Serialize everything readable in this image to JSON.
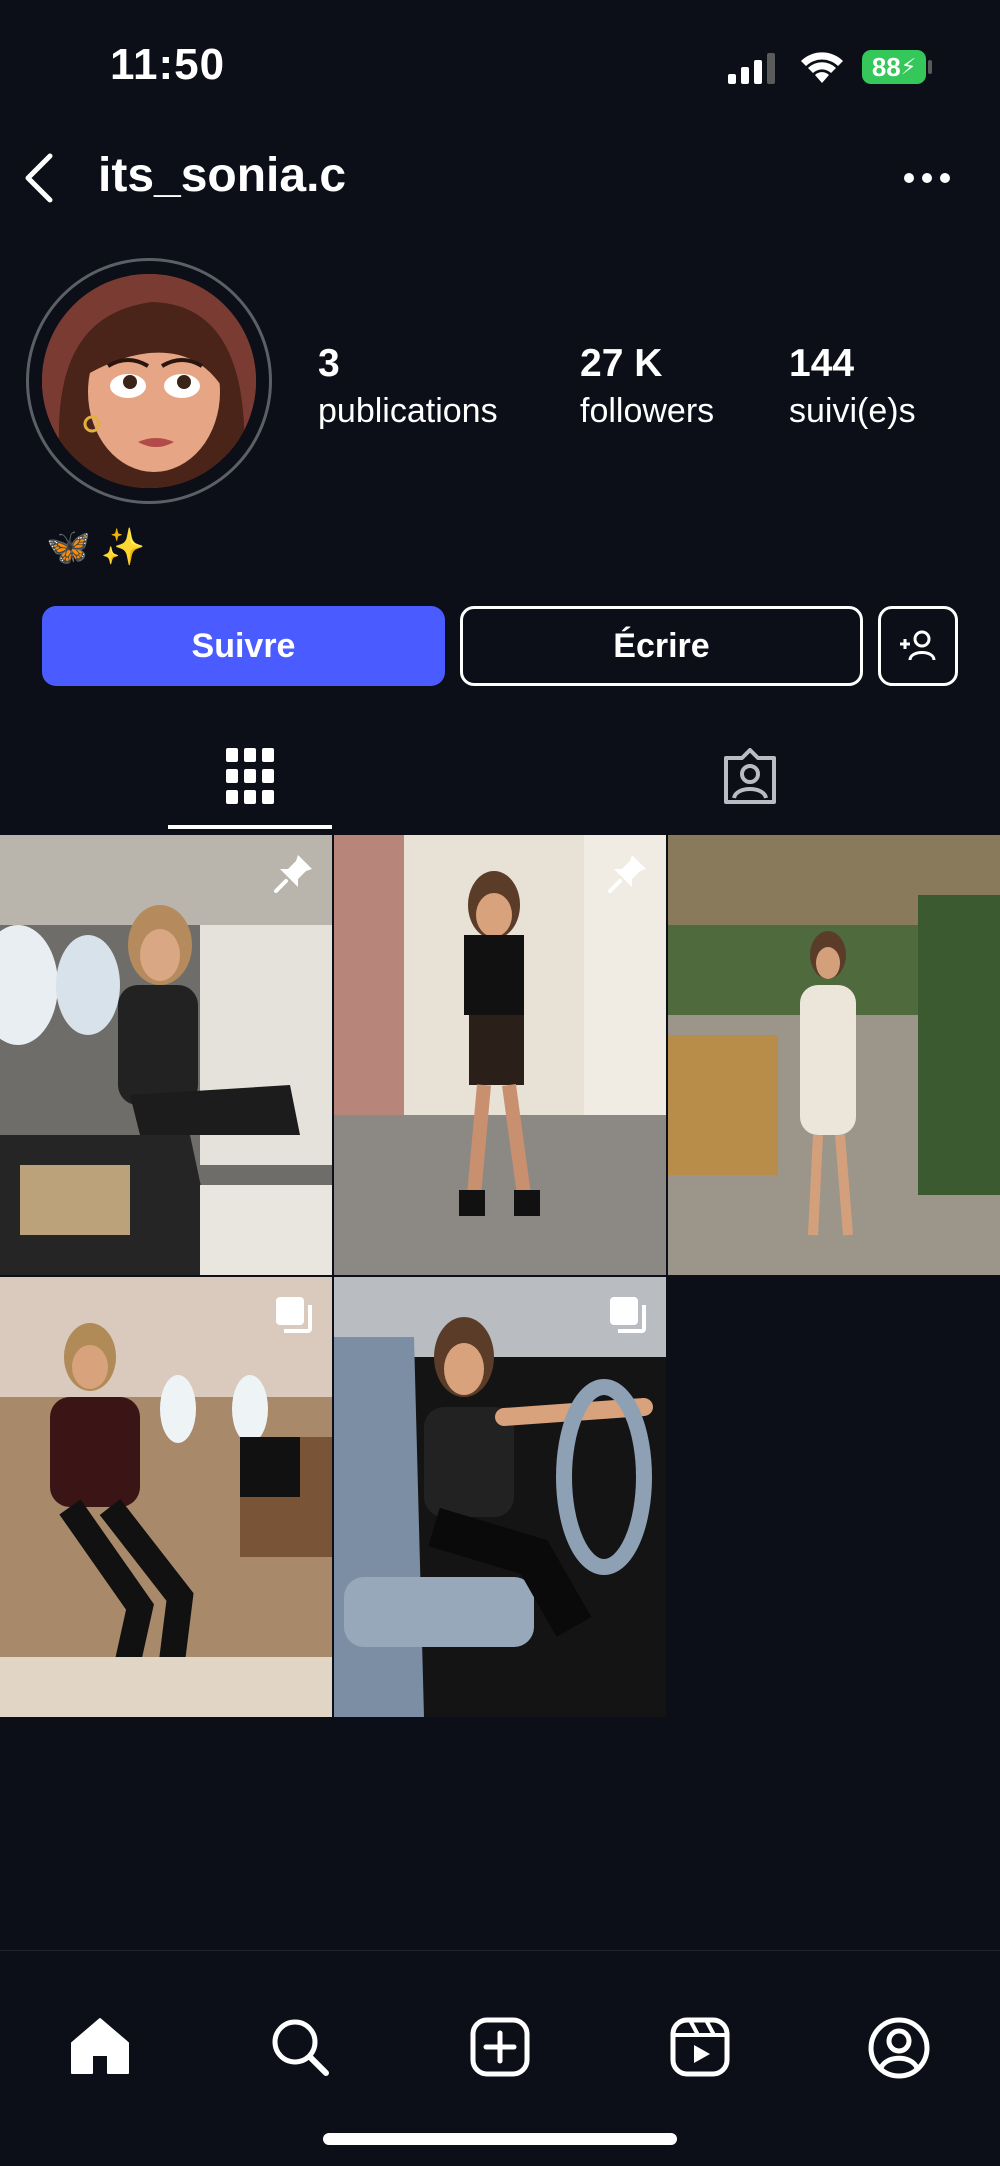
{
  "status_bar": {
    "time": "11:50",
    "battery": "88",
    "icons": [
      "signal-icon",
      "wifi-icon",
      "battery-charging-icon"
    ]
  },
  "header": {
    "username": "its_sonia.c",
    "icons": [
      "back-arrow-icon",
      "more-options-icon"
    ]
  },
  "profile": {
    "stats": [
      {
        "value": "3",
        "label": "publications"
      },
      {
        "value": "27 K",
        "label": "followers"
      },
      {
        "value": "144",
        "label": "suivi(e)s"
      }
    ],
    "bio": "🦋 ✨"
  },
  "actions": {
    "follow_label": "Suivre",
    "message_label": "Écrire",
    "add_friend_icon": "add-person-icon"
  },
  "tabs": [
    {
      "name": "grid",
      "icon": "grid-icon",
      "active": true
    },
    {
      "name": "tagged",
      "icon": "tagged-person-icon",
      "active": false
    }
  ],
  "posts": [
    {
      "badge": "pin-icon",
      "scene": "private jet cabin, seated"
    },
    {
      "badge": "pin-icon",
      "scene": "street, leaning on wall"
    },
    {
      "badge": "",
      "scene": "outdoor terrace"
    },
    {
      "badge": "carousel-icon",
      "scene": "private jet, leather jacket"
    },
    {
      "badge": "carousel-icon",
      "scene": "car driver seat"
    }
  ],
  "bottom_nav": [
    "home-icon",
    "search-icon",
    "create-icon",
    "reels-icon",
    "profile-icon"
  ],
  "colors": {
    "background": "#0c0f17",
    "accent": "#4a5cff",
    "battery": "#34c759"
  }
}
